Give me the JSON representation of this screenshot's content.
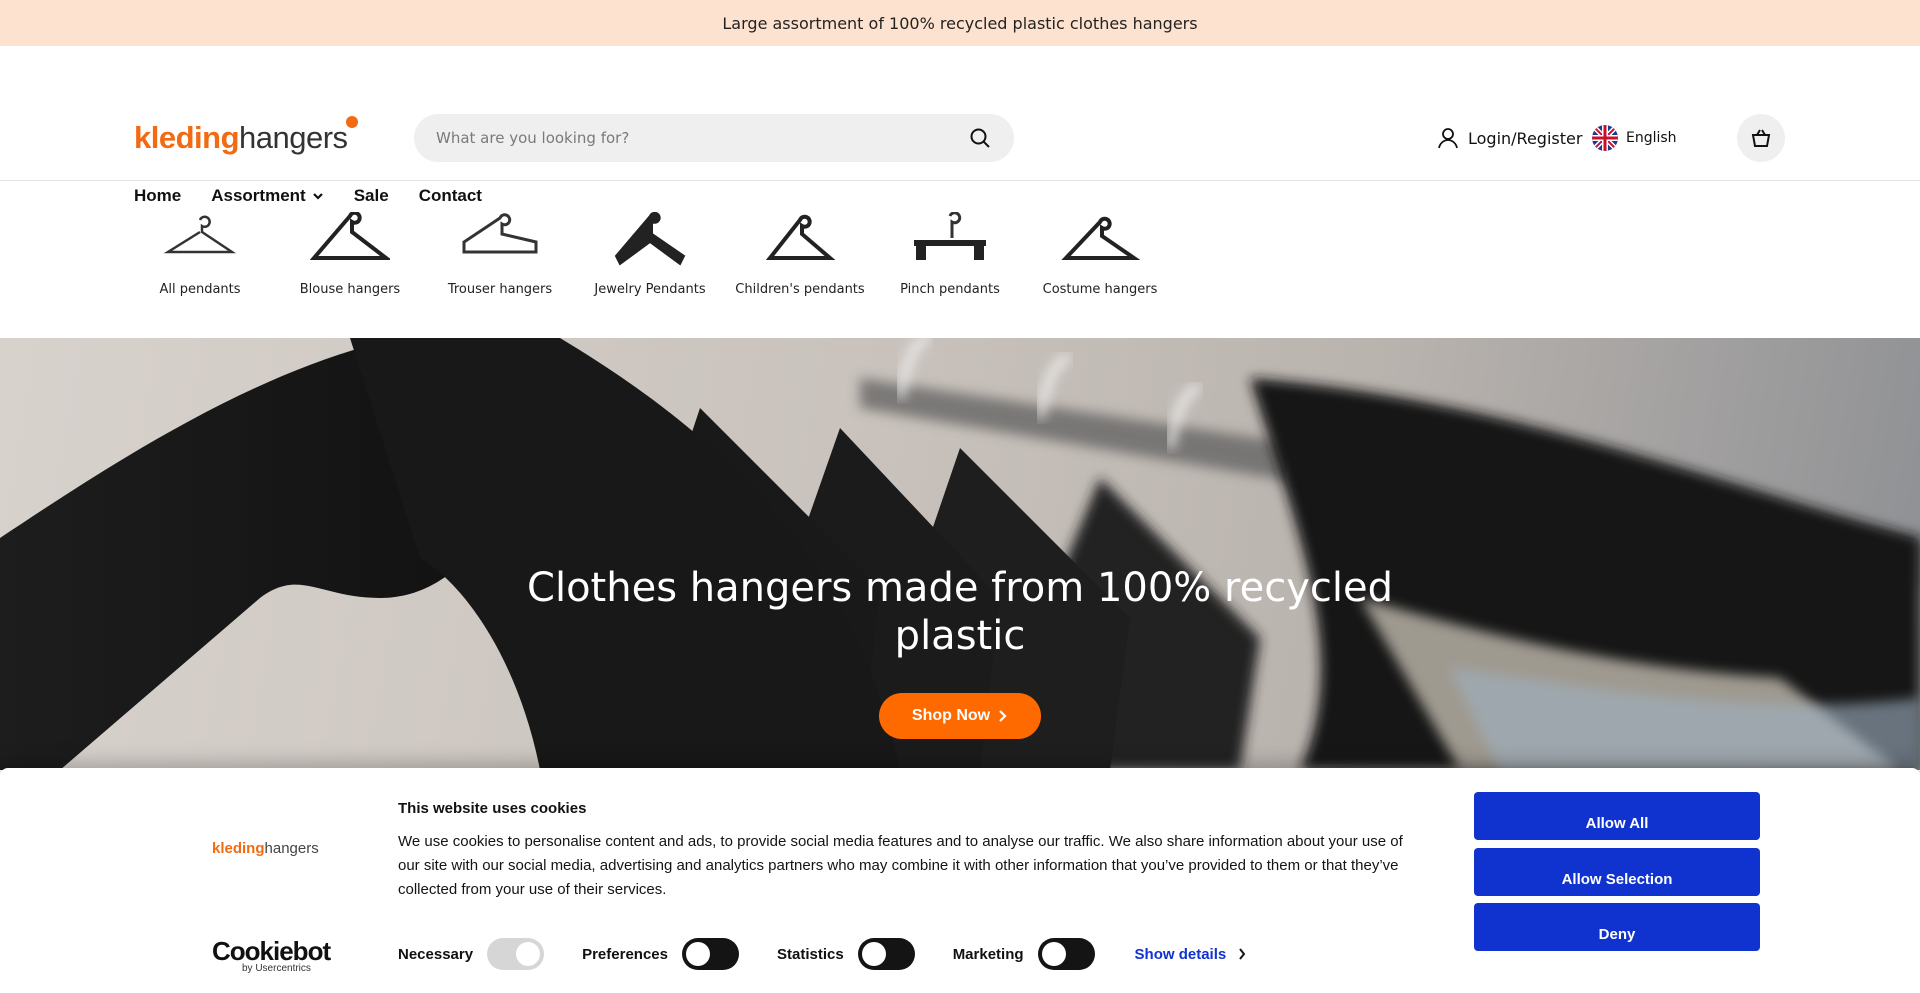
{
  "announcement": {
    "text": "Large assortment of 100% recycled plastic clothes hangers"
  },
  "header": {
    "logo": {
      "part1": "kleding",
      "part2": "hangers"
    },
    "search": {
      "placeholder": "What are you looking for?"
    },
    "login_label": "Login/Register",
    "language": "English",
    "accent_color": "#f26a12"
  },
  "nav": {
    "items": [
      {
        "label": "Home"
      },
      {
        "label": "Assortment",
        "has_dropdown": true
      },
      {
        "label": "Sale"
      },
      {
        "label": "Contact"
      }
    ]
  },
  "categories": [
    {
      "label": "All pendants"
    },
    {
      "label": "Blouse hangers"
    },
    {
      "label": "Trouser hangers"
    },
    {
      "label": "Jewelry Pendants"
    },
    {
      "label": "Children's pendants"
    },
    {
      "label": "Pinch pendants"
    },
    {
      "label": "Costume hangers"
    }
  ],
  "hero": {
    "title": "Clothes hangers made from 100% recycled plastic",
    "button_label": "Shop Now",
    "button_color": "#ff6a00"
  },
  "cookie_banner": {
    "logo": {
      "part1": "kleding",
      "part2": "hangers"
    },
    "title": "This website uses cookies",
    "text": "We use cookies to personalise content and ads, to provide social media features and to analyse our traffic. We also share information about your use of our site with our social media, advertising and analytics partners who may combine it with other information that you’ve provided to them or that they’ve collected from your use of their services.",
    "toggles": [
      {
        "label": "Necessary",
        "checked": true
      },
      {
        "label": "Preferences",
        "checked": false
      },
      {
        "label": "Statistics",
        "checked": false
      },
      {
        "label": "Marketing",
        "checked": false
      }
    ],
    "show_details": "Show details",
    "buttons": {
      "allow_all": "Allow All",
      "allow_selection": "Allow Selection",
      "deny": "Deny"
    },
    "button_color": "#1032cf",
    "provider": {
      "name": "Cookiebot",
      "by": "by Usercentrics"
    }
  }
}
